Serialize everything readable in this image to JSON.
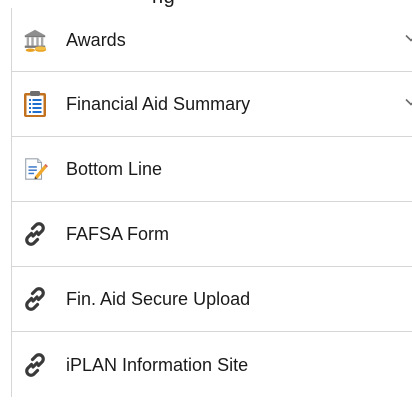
{
  "header": {
    "cut_text": "ng"
  },
  "nav": {
    "items": [
      {
        "label": "Awards",
        "icon": "bank-icon",
        "expandable": true
      },
      {
        "label": "Financial Aid Summary",
        "icon": "clipboard-list-icon",
        "expandable": true
      },
      {
        "label": "Bottom Line",
        "icon": "document-edit-icon",
        "expandable": false
      },
      {
        "label": "FAFSA Form",
        "icon": "link-icon",
        "expandable": false
      },
      {
        "label": "Fin. Aid Secure Upload",
        "icon": "link-icon",
        "expandable": false
      },
      {
        "label": "iPLAN Information Site",
        "icon": "link-icon",
        "expandable": false
      }
    ]
  },
  "colors": {
    "divider": "#d6d6d6",
    "text": "#1a1a1a",
    "link_icon": "#3a3a3a",
    "chevron": "#6b6b6b",
    "bank_icon": "#9a9a9a",
    "coin": "#e8a020",
    "clipboard_frame": "#b8651b",
    "clipboard_paper": "#ffffff",
    "list_lines": "#1f6fd1"
  }
}
